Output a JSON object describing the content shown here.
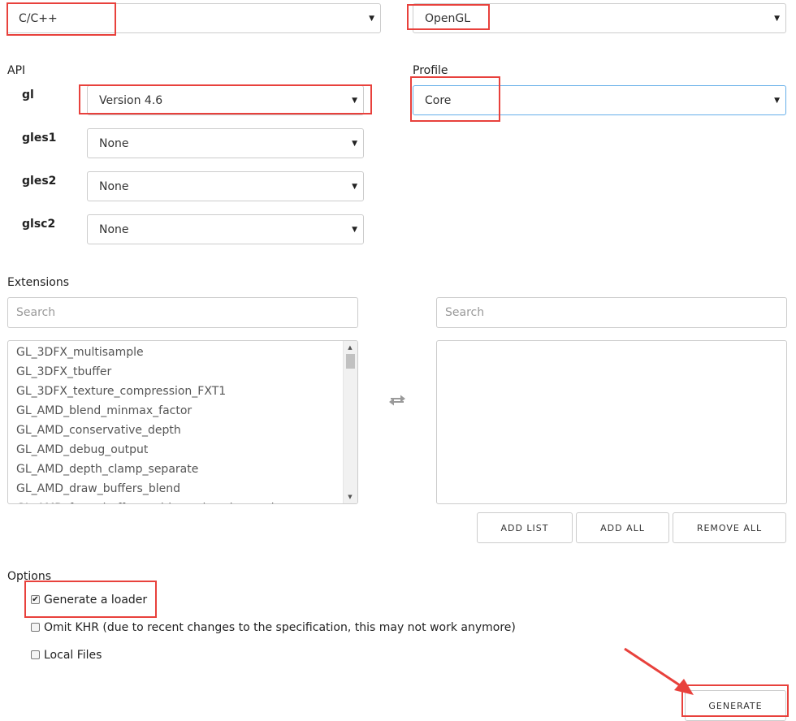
{
  "language": {
    "value": "C/C++"
  },
  "specification": {
    "value": "OpenGL"
  },
  "api": {
    "label": "API",
    "rows": [
      {
        "name": "gl",
        "value": "Version 4.6"
      },
      {
        "name": "gles1",
        "value": "None"
      },
      {
        "name": "gles2",
        "value": "None"
      },
      {
        "name": "glsc2",
        "value": "None"
      }
    ]
  },
  "profile": {
    "label": "Profile",
    "value": "Core"
  },
  "extensions": {
    "label": "Extensions",
    "left_search_placeholder": "Search",
    "right_search_placeholder": "Search",
    "available": [
      "GL_3DFX_multisample",
      "GL_3DFX_tbuffer",
      "GL_3DFX_texture_compression_FXT1",
      "GL_AMD_blend_minmax_factor",
      "GL_AMD_conservative_depth",
      "GL_AMD_debug_output",
      "GL_AMD_depth_clamp_separate",
      "GL_AMD_draw_buffers_blend",
      "GL_AMD_framebuffer_multisample_advanced"
    ],
    "selected": [],
    "transfer_icon": "swap-arrows-icon",
    "buttons": {
      "add_list": "ADD LIST",
      "add_all": "ADD ALL",
      "remove_all": "REMOVE ALL"
    }
  },
  "options": {
    "label": "Options",
    "items": [
      {
        "label": "Generate a loader",
        "checked": true
      },
      {
        "label": "Omit KHR (due to recent changes to the specification, this may not work anymore)",
        "checked": false
      },
      {
        "label": "Local Files",
        "checked": false
      }
    ]
  },
  "generate": {
    "label": "GENERATE"
  },
  "colors": {
    "highlight": "#e8413c",
    "focus_border": "#66afe9"
  }
}
